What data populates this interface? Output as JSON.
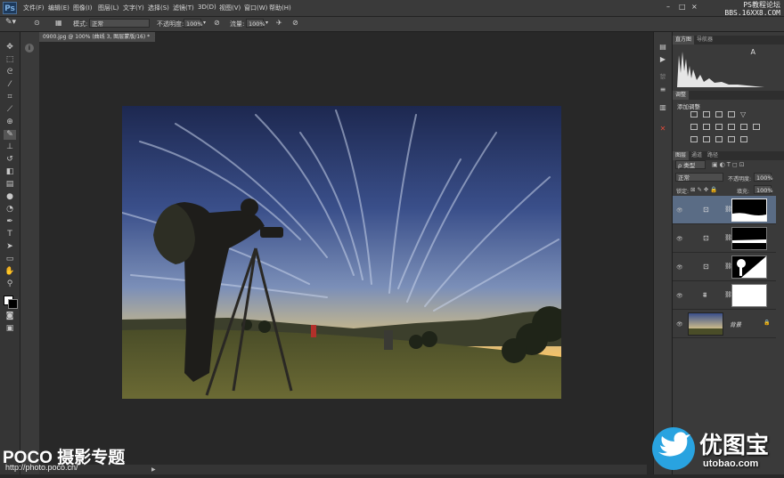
{
  "app": {
    "logo": "Ps"
  },
  "menu": [
    "文件(F)",
    "编辑(E)",
    "图像(I)",
    "图层(L)",
    "文字(Y)",
    "选择(S)",
    "滤镜(T)",
    "3D(D)",
    "视图(V)",
    "窗口(W)",
    "帮助(H)"
  ],
  "watermark_top": {
    "line1": "PS教程论坛",
    "line2": "BBS.16XX8.COM"
  },
  "options": {
    "mode_label": "模式:",
    "mode_value": "正常",
    "opacity_label": "不透明度:",
    "opacity_value": "100%",
    "flow_label": "流量:",
    "flow_value": "100%"
  },
  "document": {
    "tab_title": "0900.jpg @ 100% (曲线 3, 图层蒙版/16) *",
    "close": "×"
  },
  "panels": {
    "histogram_tabs": [
      "直方图",
      "导航器"
    ],
    "histogram_warning": "A",
    "adjust_tabs": [
      "调整"
    ],
    "adjust_title": "添加调整",
    "layers_tabs": [
      "图层",
      "通道",
      "路径"
    ],
    "layers_filter": "ρ 类型",
    "blend_mode": "正常",
    "opacity_label": "不透明度:",
    "opacity_value": "100%",
    "lock_label": "锁定:",
    "fill_label": "填充:",
    "fill_value": "100%",
    "background_layer_name": "背景"
  },
  "watermarks": {
    "poco_brand": "POCO 摄影专题",
    "poco_url": "http://photo.poco.cn/",
    "utobao_name": "优图宝",
    "utobao_url": "utobao.com"
  },
  "icons": [
    "ps-logo",
    "move-icon",
    "marquee-icon",
    "lasso-icon",
    "quick-select-icon",
    "crop-icon",
    "eyedropper-icon",
    "healing-brush-icon",
    "brush-icon",
    "stamp-icon",
    "history-brush-icon",
    "eraser-icon",
    "gradient-icon",
    "blur-icon",
    "dodge-icon",
    "pen-icon",
    "type-icon",
    "path-select-icon",
    "shape-icon",
    "hand-icon",
    "zoom-icon",
    "eye-icon",
    "lock-icon",
    "twitter-bird-icon"
  ],
  "colors": {
    "ui_bg": "#282828",
    "panel_bg": "#3a3a3a",
    "selected_layer": "#5a6c85"
  }
}
